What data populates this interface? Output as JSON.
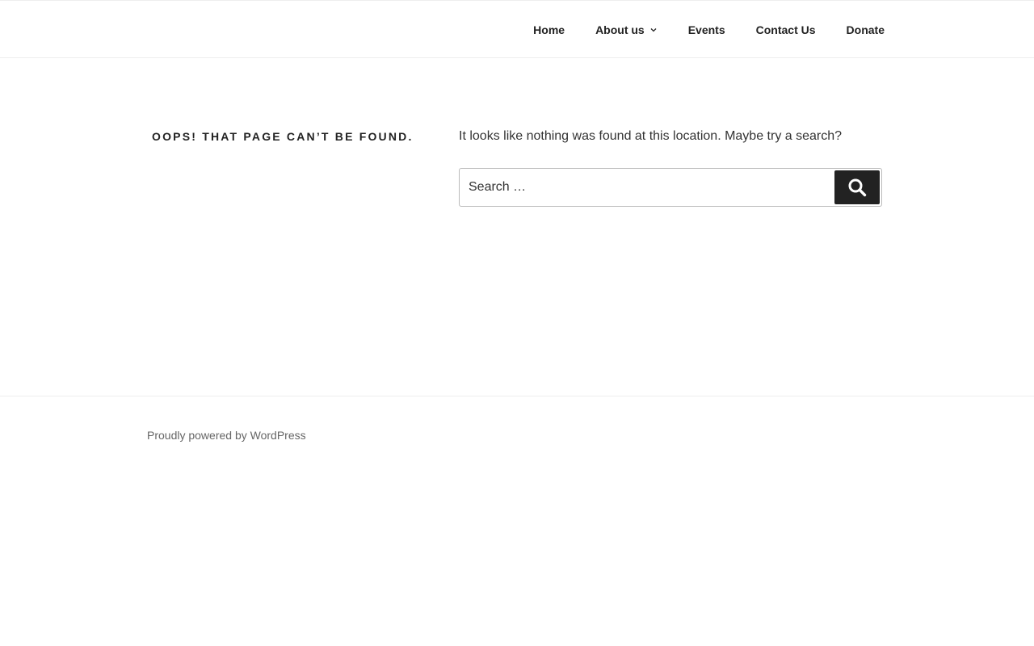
{
  "nav": {
    "items": [
      {
        "label": "Home"
      },
      {
        "label": "About us"
      },
      {
        "label": "Events"
      },
      {
        "label": "Contact Us"
      },
      {
        "label": "Donate"
      }
    ]
  },
  "main": {
    "title": "Oops! That page can’t be found.",
    "message": "It looks like nothing was found at this location. Maybe try a search?",
    "search": {
      "placeholder": "Search …",
      "button_icon": "search-icon"
    }
  },
  "footer": {
    "credit": "Proudly powered by WordPress"
  },
  "colors": {
    "text": "#222222",
    "button_bg": "#222222",
    "border": "#bbbbbb",
    "footer_text": "#666666"
  }
}
